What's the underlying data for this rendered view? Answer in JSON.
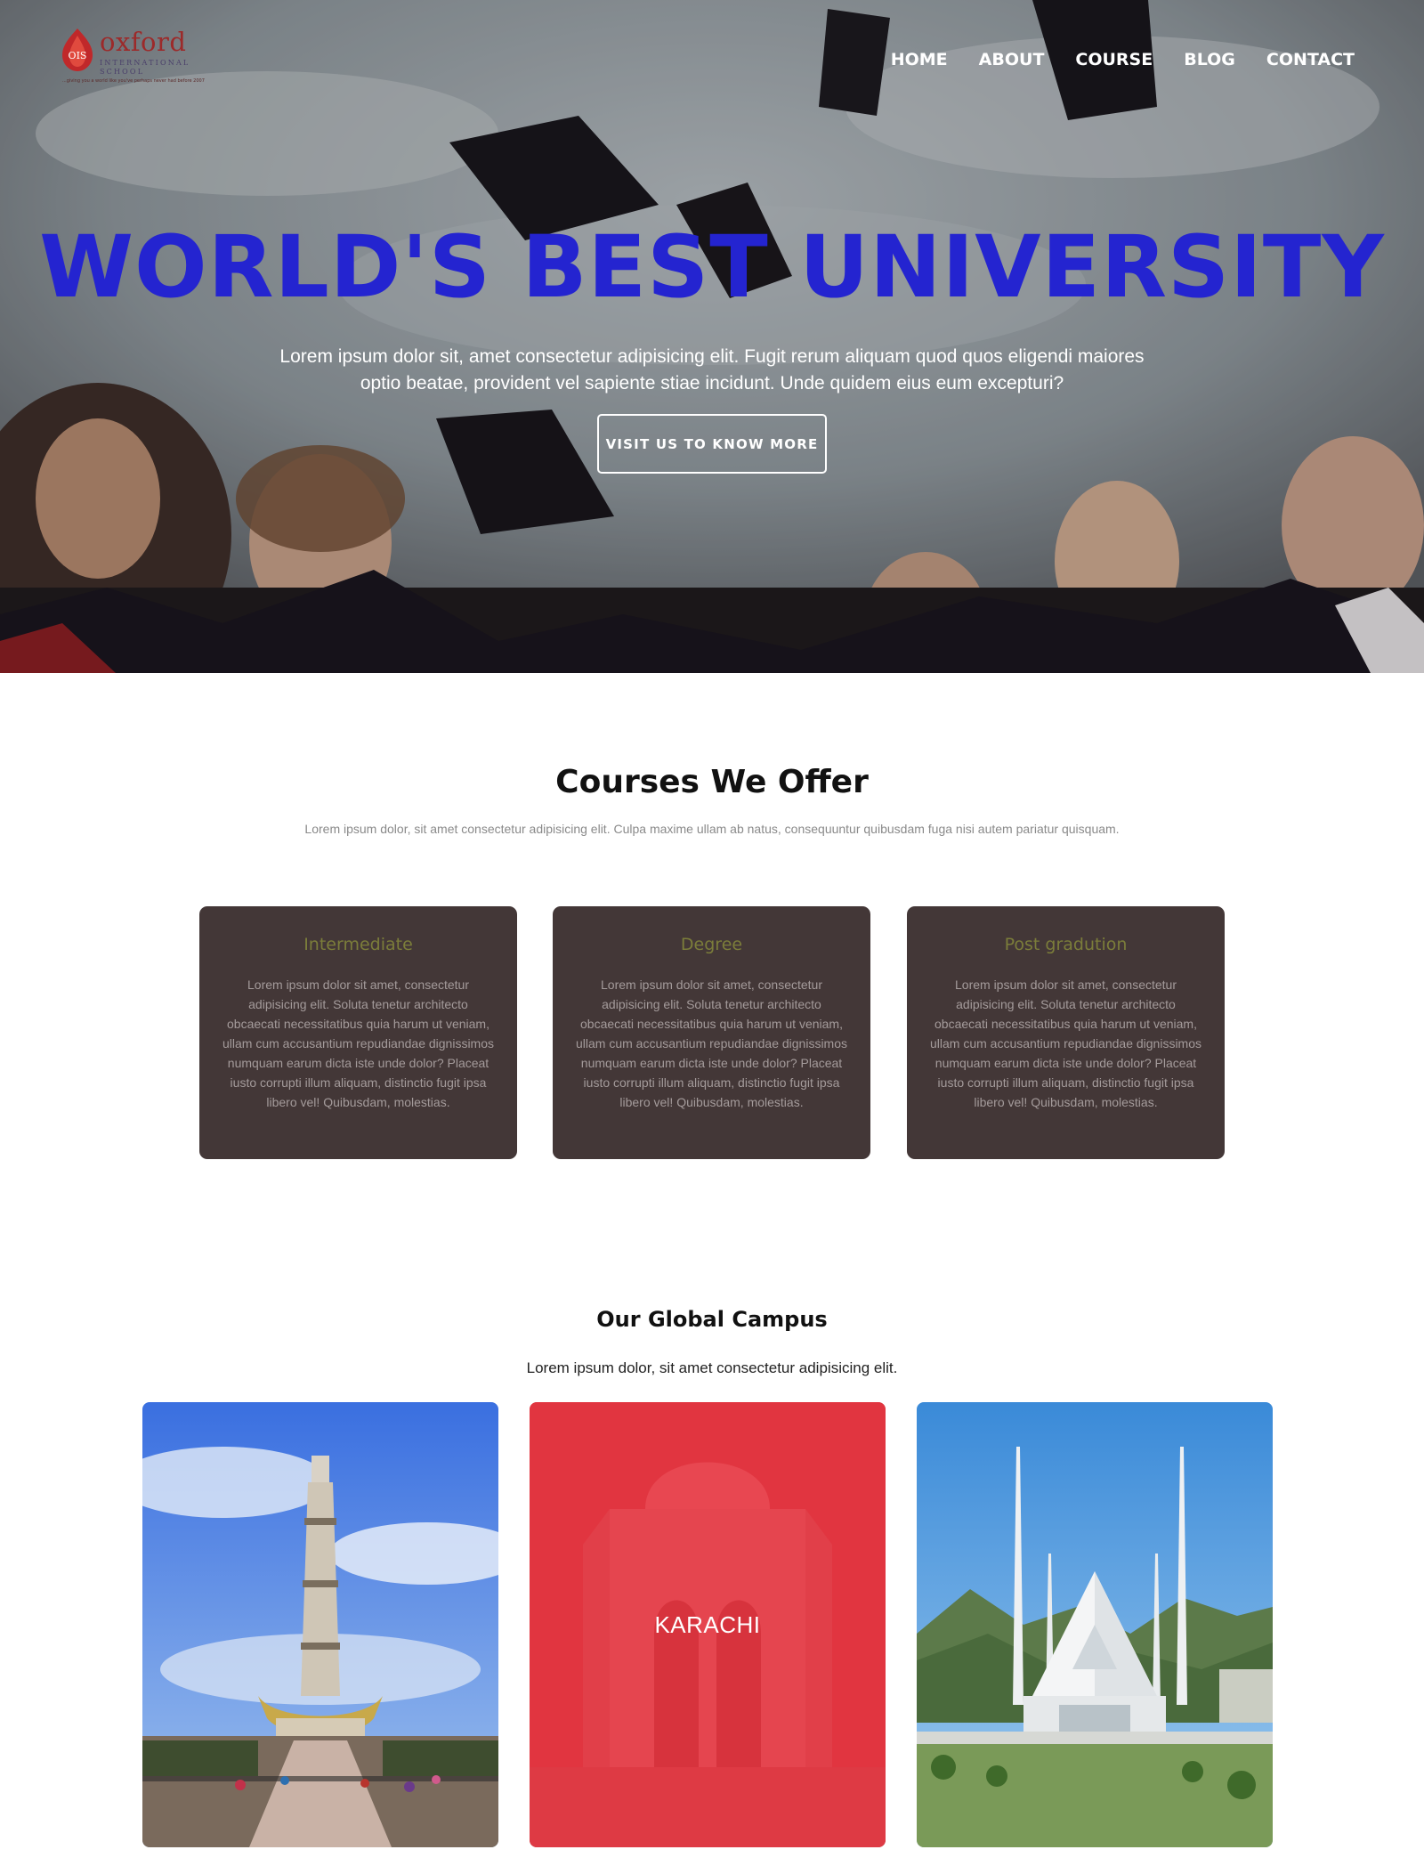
{
  "header": {
    "logo": {
      "name": "oxford",
      "subtitle": "INTERNATIONAL SCHOOL",
      "tagline": "...giving you a world like you've perhaps never had before 2007"
    },
    "nav": [
      {
        "label": "HOME"
      },
      {
        "label": "ABOUT"
      },
      {
        "label": "COURSE"
      },
      {
        "label": "BLOG"
      },
      {
        "label": "CONTACT"
      }
    ]
  },
  "hero": {
    "title": "WORLD'S BEST UNIVERSITY",
    "description": "Lorem ipsum dolor sit, amet consectetur adipisicing elit. Fugit rerum aliquam quod quos eligendi maiores optio beatae, provident vel sapiente stiae incidunt. Unde quidem eius eum excepturi?",
    "button_label": "VISIT US TO KNOW MORE"
  },
  "courses": {
    "title": "Courses We Offer",
    "subtitle": "Lorem ipsum dolor, sit amet consectetur adipisicing elit. Culpa maxime ullam ab natus, consequuntur quibusdam fuga nisi autem pariatur quisquam.",
    "cards": [
      {
        "title": "Intermediate",
        "text": "Lorem ipsum dolor sit amet, consectetur adipisicing elit. Soluta tenetur architecto obcaecati necessitatibus quia harum ut veniam, ullam cum accusantium repudiandae dignissimos numquam earum dicta iste unde dolor? Placeat iusto corrupti illum aliquam, distinctio fugit ipsa libero vel! Quibusdam, molestias."
      },
      {
        "title": "Degree",
        "text": "Lorem ipsum dolor sit amet, consectetur adipisicing elit. Soluta tenetur architecto obcaecati necessitatibus quia harum ut veniam, ullam cum accusantium repudiandae dignissimos numquam earum dicta iste unde dolor? Placeat iusto corrupti illum aliquam, distinctio fugit ipsa libero vel! Quibusdam, molestias."
      },
      {
        "title": "Post gradution",
        "text": "Lorem ipsum dolor sit amet, consectetur adipisicing elit. Soluta tenetur architecto obcaecati necessitatibus quia harum ut veniam, ullam cum accusantium repudiandae dignissimos numquam earum dicta iste unde dolor? Placeat iusto corrupti illum aliquam, distinctio fugit ipsa libero vel! Quibusdam, molestias."
      }
    ]
  },
  "campus": {
    "title": "Our Global Campus",
    "subtitle": "Lorem ipsum dolor, sit amet consectetur adipisicing elit.",
    "items": [
      {
        "city": ""
      },
      {
        "city": "KARACHI"
      },
      {
        "city": ""
      }
    ]
  },
  "colors": {
    "hero_title": "#2424d0",
    "card_bg": "#433737",
    "card_title": "#7b7d3a",
    "campus_overlay": "#e81e2d"
  }
}
